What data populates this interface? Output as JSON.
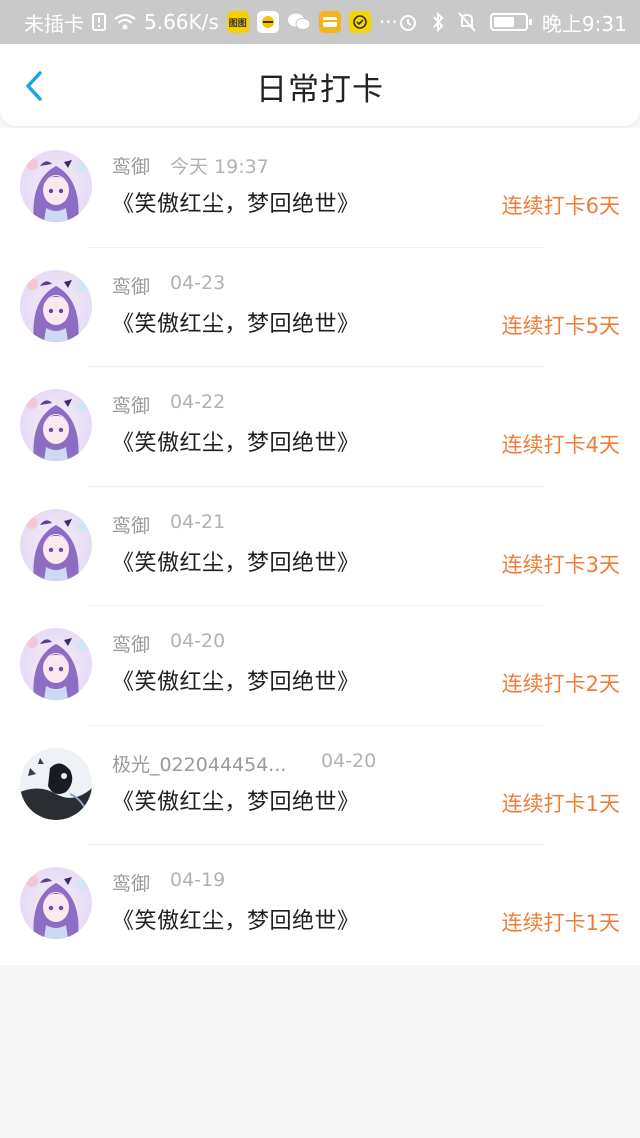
{
  "status_bar": {
    "carrier": "未插卡",
    "speed": "5.66K/s",
    "time": "晚上9:31",
    "app_icons": [
      "图图",
      "bee-icon",
      "wechat-icon",
      "wallet-icon",
      "check-icon"
    ],
    "more": "···"
  },
  "nav": {
    "title": "日常打卡",
    "back_icon": "chevron-left-icon"
  },
  "colors": {
    "accent": "#f07d37",
    "back": "#1aa3f0",
    "statusbar": "#c9c9c9"
  },
  "checkins": [
    {
      "user": "鸾御",
      "time": "今天 19:37",
      "book": "《笑傲红尘，梦回绝世》",
      "streak": "连续打卡6天",
      "avatar": "anime-girl-avatar"
    },
    {
      "user": "鸾御",
      "time": "04-23",
      "book": "《笑傲红尘，梦回绝世》",
      "streak": "连续打卡5天",
      "avatar": "anime-girl-avatar"
    },
    {
      "user": "鸾御",
      "time": "04-22",
      "book": "《笑傲红尘，梦回绝世》",
      "streak": "连续打卡4天",
      "avatar": "anime-girl-avatar"
    },
    {
      "user": "鸾御",
      "time": "04-21",
      "book": "《笑傲红尘，梦回绝世》",
      "streak": "连续打卡3天",
      "avatar": "anime-girl-avatar"
    },
    {
      "user": "鸾御",
      "time": "04-20",
      "book": "《笑傲红尘，梦回绝世》",
      "streak": "连续打卡2天",
      "avatar": "anime-girl-avatar"
    },
    {
      "user": "极光_022044454...",
      "time": "04-20",
      "book": "《笑傲红尘，梦回绝世》",
      "streak": "连续打卡1天",
      "avatar": "dark-figure-avatar"
    },
    {
      "user": "鸾御",
      "time": "04-19",
      "book": "《笑傲红尘，梦回绝世》",
      "streak": "连续打卡1天",
      "avatar": "anime-girl-avatar"
    }
  ]
}
